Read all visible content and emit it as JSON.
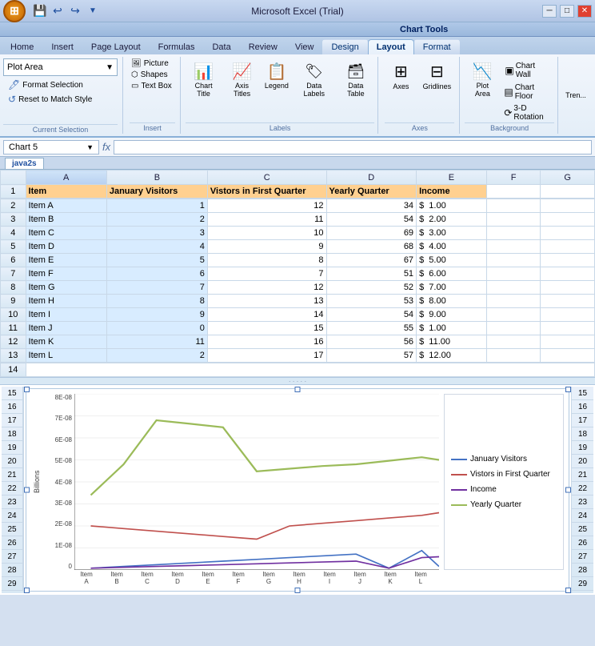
{
  "app": {
    "title": "Microsoft Excel (Trial)",
    "chart_tools_label": "Chart Tools"
  },
  "tabs": {
    "main": [
      "Home",
      "Insert",
      "Page Layout",
      "Formulas",
      "Data",
      "Review",
      "View"
    ],
    "chart": [
      "Design",
      "Layout",
      "Format"
    ]
  },
  "active_tab": "Layout",
  "ribbon": {
    "groups": {
      "current_selection": {
        "label": "Current Selection",
        "dropdown": "Plot Area",
        "buttons": [
          "Format Selection",
          "Reset to Match Style"
        ]
      },
      "insert": {
        "label": "Insert",
        "buttons": [
          "Picture",
          "Shapes",
          "Text Box"
        ]
      },
      "labels": {
        "label": "Labels",
        "buttons": [
          "Chart Title",
          "Axis Titles",
          "Legend",
          "Data Labels",
          "Data Table"
        ]
      },
      "axes": {
        "label": "Axes",
        "buttons": [
          "Axes",
          "Gridlines"
        ]
      },
      "background": {
        "label": "Background",
        "buttons": [
          "Plot Area"
        ],
        "right_buttons": [
          "Chart Wall",
          "Chart Floor",
          "3-D Rotation"
        ]
      }
    }
  },
  "formula_bar": {
    "name_box": "Chart 5",
    "fx": "fx",
    "formula": ""
  },
  "workbook_tab": "java2s",
  "columns": [
    "",
    "A",
    "B",
    "C",
    "D",
    "E",
    "F",
    "G"
  ],
  "headers": [
    "Item",
    "January Visitors",
    "Vistors in First Quarter",
    "Yearly Quarter",
    "Income",
    "",
    ""
  ],
  "rows": [
    {
      "num": 2,
      "a": "Item A",
      "b": "1",
      "c": "12",
      "d": "34",
      "e": "1.00"
    },
    {
      "num": 3,
      "a": "Item B",
      "b": "2",
      "c": "11",
      "d": "54",
      "e": "2.00"
    },
    {
      "num": 4,
      "a": "Item C",
      "b": "3",
      "c": "10",
      "d": "69",
      "e": "3.00"
    },
    {
      "num": 5,
      "a": "Item D",
      "b": "4",
      "c": "9",
      "d": "68",
      "e": "4.00"
    },
    {
      "num": 6,
      "a": "Item E",
      "b": "5",
      "c": "8",
      "d": "67",
      "e": "5.00"
    },
    {
      "num": 7,
      "a": "Item F",
      "b": "6",
      "c": "7",
      "d": "51",
      "e": "6.00"
    },
    {
      "num": 8,
      "a": "Item G",
      "b": "7",
      "c": "12",
      "d": "52",
      "e": "7.00"
    },
    {
      "num": 9,
      "a": "Item H",
      "b": "8",
      "c": "13",
      "d": "53",
      "e": "8.00"
    },
    {
      "num": 10,
      "a": "Item I",
      "b": "9",
      "c": "14",
      "d": "54",
      "e": "9.00"
    },
    {
      "num": 11,
      "a": "Item J",
      "b": "0",
      "c": "15",
      "d": "55",
      "e": "1.00"
    },
    {
      "num": 12,
      "a": "Item K",
      "b": "11",
      "c": "16",
      "d": "56",
      "e": "11.00"
    },
    {
      "num": 13,
      "a": "Item L",
      "b": "2",
      "c": "17",
      "d": "57",
      "e": "12.00"
    }
  ],
  "chart": {
    "y_labels": [
      "8E-08",
      "7E-08",
      "6E-08",
      "5E-08",
      "4E-08",
      "3E-08",
      "2E-08",
      "1E-08",
      "0"
    ],
    "y_axis_title": "Billions",
    "x_labels": [
      "Item A",
      "Item B",
      "Item C",
      "Item D",
      "Item E",
      "Item F",
      "Item G",
      "Item H",
      "Item I",
      "Item J",
      "Item K",
      "Item L"
    ],
    "legend": [
      {
        "label": "January Visitors",
        "color": "#4472c4"
      },
      {
        "label": "Vistors in First Quarter",
        "color": "#c0504d"
      },
      {
        "label": "Income",
        "color": "#7030a0"
      },
      {
        "label": "Yearly Quarter",
        "color": "#9bbb59"
      }
    ]
  }
}
